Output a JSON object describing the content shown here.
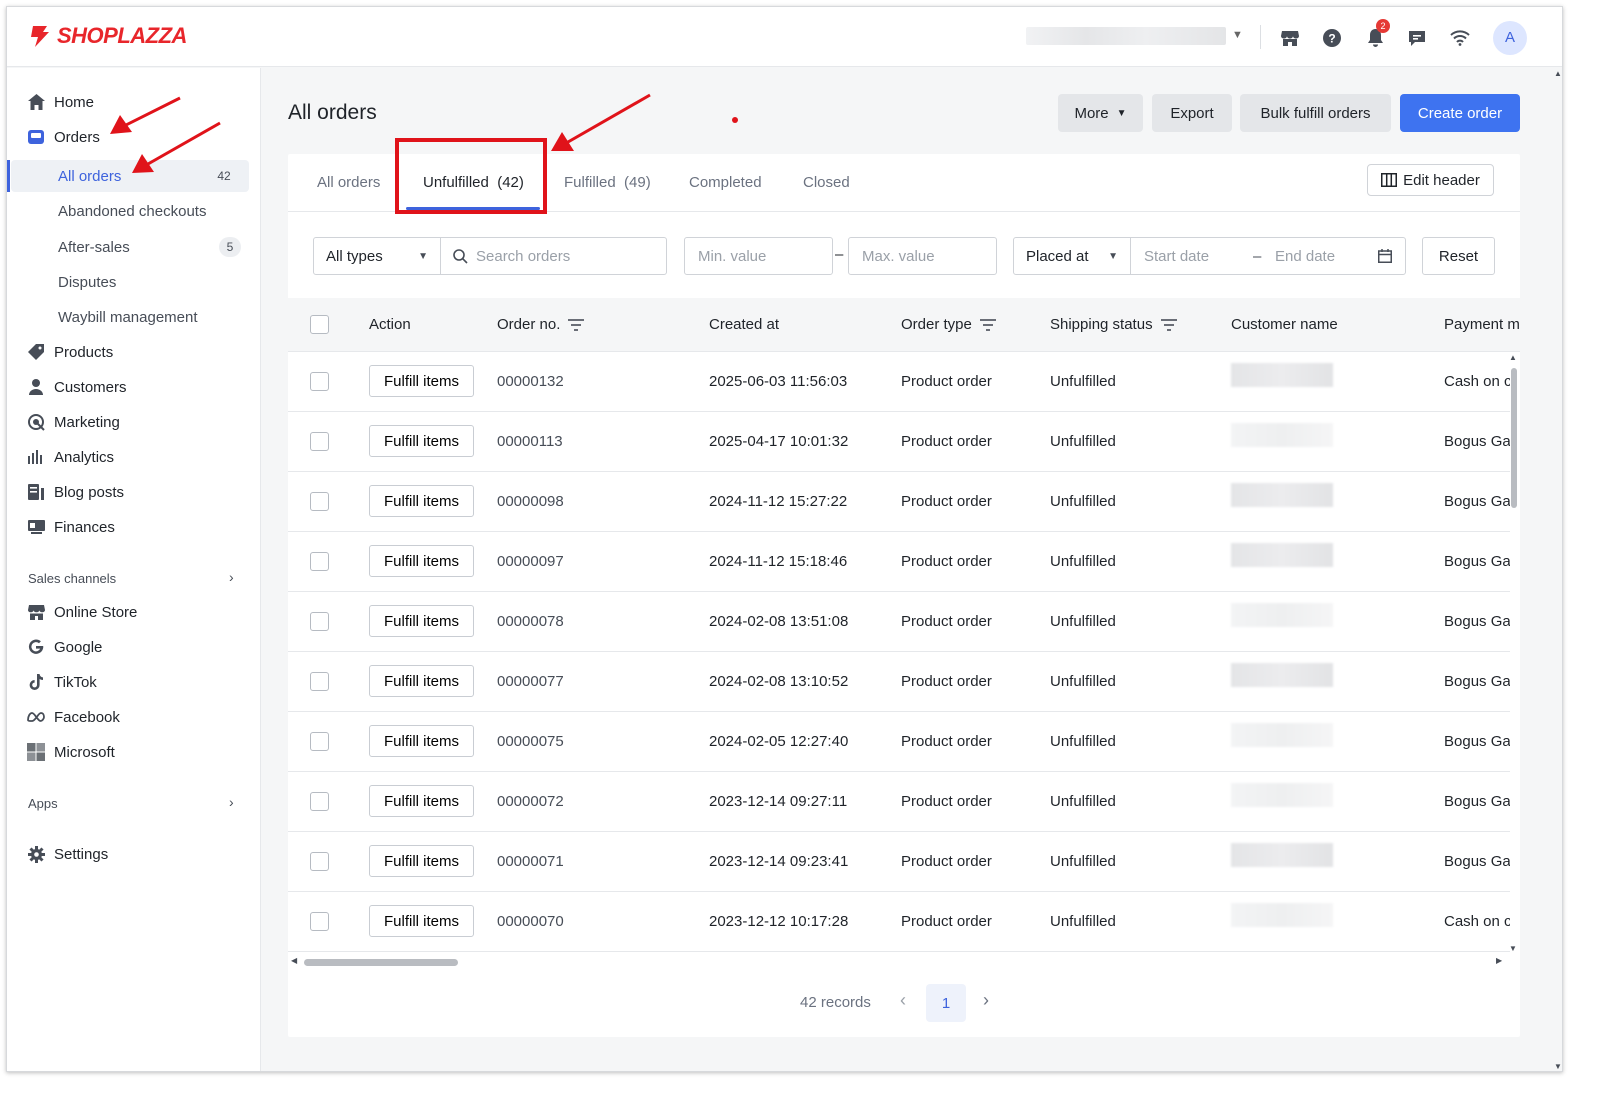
{
  "app": {
    "logo_text": "SHOPLAZZA",
    "avatar_letter": "A",
    "notification_count": "2"
  },
  "sidebar": {
    "main_items": [
      {
        "label": "Home",
        "icon": "home-icon"
      },
      {
        "label": "Orders",
        "icon": "orders-icon"
      }
    ],
    "order_subitems": [
      {
        "label": "All orders",
        "count": "42",
        "active": true
      },
      {
        "label": "Abandoned checkouts"
      },
      {
        "label": "After-sales",
        "count": "5"
      },
      {
        "label": "Disputes"
      },
      {
        "label": "Waybill management"
      }
    ],
    "more_items": [
      {
        "label": "Products",
        "icon": "tag-icon"
      },
      {
        "label": "Customers",
        "icon": "person-icon"
      },
      {
        "label": "Marketing",
        "icon": "marketing-icon"
      },
      {
        "label": "Analytics",
        "icon": "bar-chart-icon"
      },
      {
        "label": "Blog posts",
        "icon": "blog-icon"
      },
      {
        "label": "Finances",
        "icon": "finance-icon"
      }
    ],
    "sales_channels_label": "Sales channels",
    "channels": [
      {
        "label": "Online Store",
        "icon": "store-icon"
      },
      {
        "label": "Google",
        "icon": "google-icon"
      },
      {
        "label": "TikTok",
        "icon": "tiktok-icon"
      },
      {
        "label": "Facebook",
        "icon": "meta-icon"
      },
      {
        "label": "Microsoft",
        "icon": "microsoft-icon"
      }
    ],
    "apps_label": "Apps",
    "settings_label": "Settings"
  },
  "header": {
    "title": "All orders",
    "buttons": {
      "more": "More",
      "export": "Export",
      "bulk": "Bulk fulfill orders",
      "create": "Create order"
    }
  },
  "tabs": [
    {
      "label": "All orders"
    },
    {
      "label": "Unfulfilled  (42)",
      "active": true
    },
    {
      "label": "Fulfilled  (49)"
    },
    {
      "label": "Completed"
    },
    {
      "label": "Closed"
    }
  ],
  "edit_header_label": "Edit header",
  "filters": {
    "type_value": "All types",
    "search_placeholder": "Search orders",
    "min_placeholder": "Min. value",
    "max_placeholder": "Max. value",
    "range_dash": "–",
    "date_field": "Placed at",
    "start_placeholder": "Start date",
    "end_placeholder": "End date",
    "reset": "Reset"
  },
  "table": {
    "headers": {
      "action": "Action",
      "order_no": "Order no.",
      "created": "Created at",
      "order_type": "Order type",
      "shipping": "Shipping status",
      "customer": "Customer name",
      "payment": "Payment m"
    },
    "action_label": "Fulfill items",
    "rows": [
      {
        "order_no": "00000132",
        "created": "2025-06-03 11:56:03",
        "type": "Product order",
        "status": "Unfulfilled",
        "payment": "Cash on c"
      },
      {
        "order_no": "00000113",
        "created": "2025-04-17 10:01:32",
        "type": "Product order",
        "status": "Unfulfilled",
        "payment": "Bogus Ga"
      },
      {
        "order_no": "00000098",
        "created": "2024-11-12 15:27:22",
        "type": "Product order",
        "status": "Unfulfilled",
        "payment": "Bogus Ga"
      },
      {
        "order_no": "00000097",
        "created": "2024-11-12 15:18:46",
        "type": "Product order",
        "status": "Unfulfilled",
        "payment": "Bogus Ga"
      },
      {
        "order_no": "00000078",
        "created": "2024-02-08 13:51:08",
        "type": "Product order",
        "status": "Unfulfilled",
        "payment": "Bogus Ga"
      },
      {
        "order_no": "00000077",
        "created": "2024-02-08 13:10:52",
        "type": "Product order",
        "status": "Unfulfilled",
        "payment": "Bogus Ga"
      },
      {
        "order_no": "00000075",
        "created": "2024-02-05 12:27:40",
        "type": "Product order",
        "status": "Unfulfilled",
        "payment": "Bogus Ga"
      },
      {
        "order_no": "00000072",
        "created": "2023-12-14 09:27:11",
        "type": "Product order",
        "status": "Unfulfilled",
        "payment": "Bogus Ga"
      },
      {
        "order_no": "00000071",
        "created": "2023-12-14 09:23:41",
        "type": "Product order",
        "status": "Unfulfilled",
        "payment": "Bogus Ga"
      },
      {
        "order_no": "00000070",
        "created": "2023-12-12 10:17:28",
        "type": "Product order",
        "status": "Unfulfilled",
        "payment": "Cash on c"
      }
    ]
  },
  "pagination": {
    "records": "42 records",
    "current_page": "1"
  },
  "colors": {
    "accent": "#3e63dd",
    "primary_button": "#3e73f0",
    "annotation_red": "#e0131a",
    "brand_red": "#e8262b"
  }
}
